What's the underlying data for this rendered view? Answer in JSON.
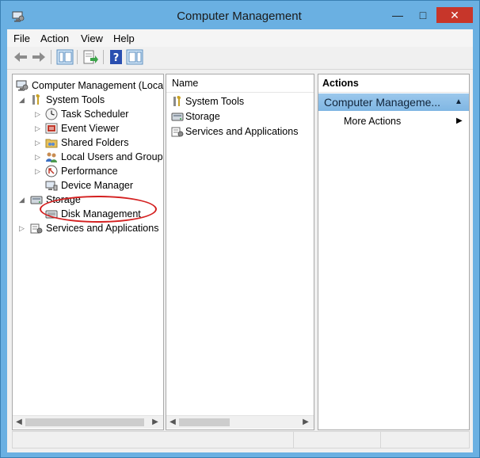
{
  "window": {
    "title": "Computer Management",
    "controls": {
      "minimize": "—",
      "maximize": "□",
      "close": "✕"
    }
  },
  "menu": [
    "File",
    "Action",
    "View",
    "Help"
  ],
  "toolbar": {
    "buttons": [
      "back-arrow-icon",
      "forward-arrow-icon",
      "show-hide-tree-icon",
      "export-list-icon",
      "help-icon",
      "action-pane-icon"
    ]
  },
  "tree": {
    "root": "Computer Management (Local",
    "items": {
      "system_tools": "System Tools",
      "task_scheduler": "Task Scheduler",
      "event_viewer": "Event Viewer",
      "shared_folders": "Shared Folders",
      "local_users": "Local Users and Groups",
      "performance": "Performance",
      "device_manager": "Device Manager",
      "storage": "Storage",
      "disk_management": "Disk Management",
      "services": "Services and Applications"
    }
  },
  "list": {
    "header": "Name",
    "items": [
      "System Tools",
      "Storage",
      "Services and Applications"
    ]
  },
  "actions": {
    "header": "Actions",
    "group": "Computer Manageme...",
    "more": "More Actions"
  },
  "colors": {
    "window_frame": "#6ab0e2",
    "close_button": "#c7362a",
    "actions_group": "#9cc8ec",
    "annotation": "#d42020"
  }
}
